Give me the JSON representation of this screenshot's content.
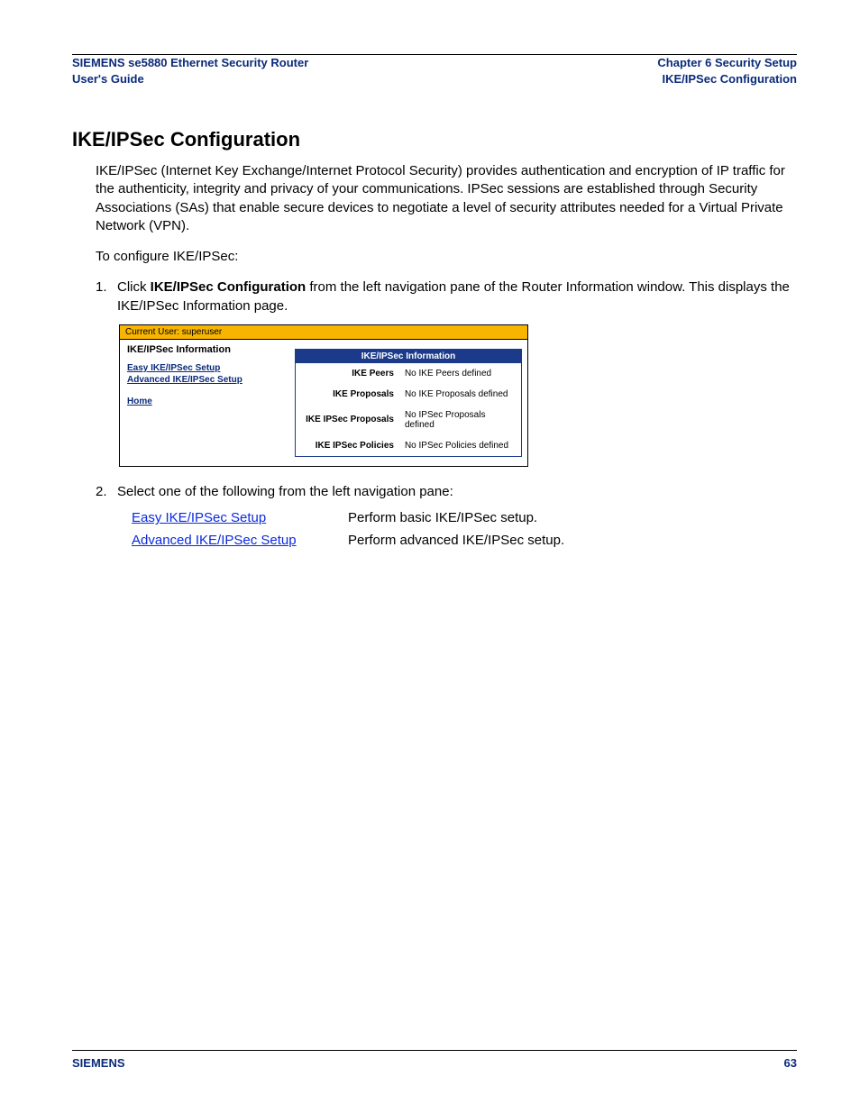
{
  "header": {
    "left_line1": "SIEMENS se5880 Ethernet Security Router",
    "left_line2": "User's Guide",
    "right_line1": "Chapter 6  Security Setup",
    "right_line2": "IKE/IPSec Configuration"
  },
  "title": "IKE/IPSec Configuration",
  "intro": "IKE/IPSec (Internet Key Exchange/Internet Protocol Security) provides authentication and encryption of IP traffic for the authenticity, integrity and privacy of your communications. IPSec sessions are established through Security Associations (SAs) that enable secure devices to negotiate a level of security attributes needed for a Virtual Private Network (VPN).",
  "lead": "To configure IKE/IPSec:",
  "steps": {
    "s1_num": "1.",
    "s1_a": "Click ",
    "s1_bold": "IKE/IPSec Configuration",
    "s1_b": " from the left navigation pane of the Router Information window. This displays the IKE/IPSec Information page.",
    "s2_num": "2.",
    "s2_text": "Select one of the following from the left navigation pane:"
  },
  "screenshot": {
    "current_user": "Current User: superuser",
    "nav_title": "IKE/IPSec Information",
    "nav_links": {
      "easy": "Easy IKE/IPSec Setup",
      "advanced": "Advanced IKE/IPSec Setup",
      "home": "Home"
    },
    "table_title": "IKE/IPSec Information",
    "rows": [
      {
        "k": "IKE Peers",
        "v": "No IKE Peers defined"
      },
      {
        "k": "IKE Proposals",
        "v": "No IKE Proposals defined"
      },
      {
        "k": "IKE IPSec Proposals",
        "v": "No IPSec Proposals defined"
      },
      {
        "k": "IKE IPSec Policies",
        "v": "No IPSec Policies defined"
      }
    ]
  },
  "options": [
    {
      "link": "Easy IKE/IPSec Setup",
      "desc": "Perform basic IKE/IPSec setup."
    },
    {
      "link": "Advanced IKE/IPSec Setup",
      "desc": "Perform advanced IKE/IPSec setup."
    }
  ],
  "footer": {
    "brand": "SIEMENS",
    "page": "63"
  }
}
